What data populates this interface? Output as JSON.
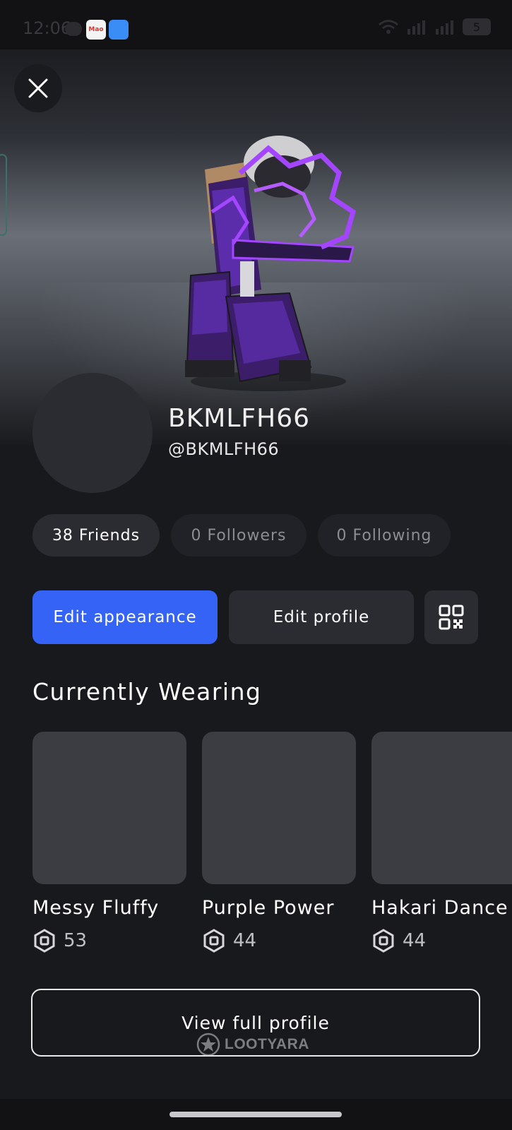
{
  "status_bar": {
    "time": "12:06",
    "battery": "5",
    "icons": [
      "chat-bubble-icon",
      "app-badge-icon",
      "app-market-icon",
      "wifi-icon",
      "signal-icon",
      "signal-icon",
      "battery-icon"
    ],
    "app_badge_text": "Mao",
    "app_market_text": "App Market"
  },
  "profile": {
    "display_name": "BKMLFH66",
    "username": "@BKMLFH66"
  },
  "stats": {
    "friends": "38 Friends",
    "followers": "0 Followers",
    "following": "0 Following"
  },
  "actions": {
    "edit_appearance": "Edit appearance",
    "edit_profile": "Edit profile",
    "qr_icon": "qr-code-icon"
  },
  "wearing": {
    "title": "Currently Wearing",
    "items": [
      {
        "name": "Messy Fluffy",
        "price": "53"
      },
      {
        "name": "Purple Power",
        "price": "44"
      },
      {
        "name": "Hakari Dance",
        "price": "44"
      }
    ]
  },
  "footer": {
    "view_full_profile": "View full profile",
    "watermark": "LOOTYARA"
  },
  "colors": {
    "background": "#18191c",
    "accent": "#3563f5",
    "surface": "#2a2c32",
    "card": "#3b3d43",
    "avatar_purple": "#8b2cf5"
  }
}
